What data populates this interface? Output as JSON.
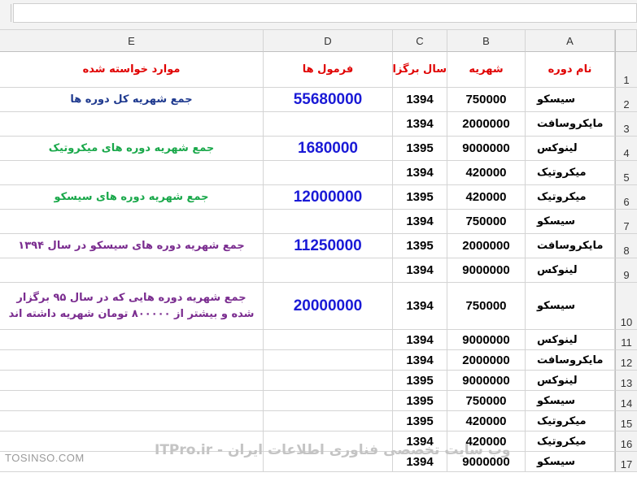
{
  "column_headers": [
    "E",
    "D",
    "C",
    "B",
    "A"
  ],
  "row_numbers": [
    "1",
    "2",
    "3",
    "4",
    "5",
    "6",
    "7",
    "8",
    "9",
    "10",
    "11",
    "12",
    "13",
    "14",
    "15",
    "16",
    "17"
  ],
  "header_row": {
    "a": "نام دوره",
    "b": "شهریه",
    "c": "سال برگزاری",
    "d": "فرمول ها",
    "e": "موارد خواسته شده"
  },
  "rows": [
    {
      "course": "سیسکو",
      "fee": "750000",
      "year": "1394"
    },
    {
      "course": "مایکروسافت",
      "fee": "2000000",
      "year": "1394"
    },
    {
      "course": "لینوکس",
      "fee": "9000000",
      "year": "1395"
    },
    {
      "course": "میکروتیک",
      "fee": "420000",
      "year": "1394"
    },
    {
      "course": "میکروتیک",
      "fee": "420000",
      "year": "1395"
    },
    {
      "course": "سیسکو",
      "fee": "750000",
      "year": "1394"
    },
    {
      "course": "مایکروسافت",
      "fee": "2000000",
      "year": "1395"
    },
    {
      "course": "لینوکس",
      "fee": "9000000",
      "year": "1394"
    },
    {
      "course": "سیسکو",
      "fee": "750000",
      "year": "1394"
    },
    {
      "course": "لینوکس",
      "fee": "9000000",
      "year": "1394"
    },
    {
      "course": "مایکروسافت",
      "fee": "2000000",
      "year": "1394"
    },
    {
      "course": "لینوکس",
      "fee": "9000000",
      "year": "1395"
    },
    {
      "course": "سیسکو",
      "fee": "750000",
      "year": "1395"
    },
    {
      "course": "میکروتیک",
      "fee": "420000",
      "year": "1395"
    },
    {
      "course": "میکروتیک",
      "fee": "420000",
      "year": "1394"
    },
    {
      "course": "سیسکو",
      "fee": "9000000",
      "year": "1394"
    }
  ],
  "questions": [
    {
      "text": "جمع شهریه کل دوره ها",
      "formula": "55680000",
      "color": "#1f3a8f"
    },
    {
      "text": "جمع شهریه دوره های میکروتیک",
      "formula": "1680000",
      "color": "#19a84a"
    },
    {
      "text": "جمع شهریه دوره های سیسکو",
      "formula": "12000000",
      "color": "#19a84a"
    },
    {
      "text": "جمع شهریه دوره های سیسکو در سال ۱۳۹۴",
      "formula": "11250000",
      "color": "#7a2c8f"
    },
    {
      "text": "جمع شهریه دوره هایی که در سال ۹۵ برگزار شده و بیشتر از ۸۰۰۰۰۰ تومان شهریه داشته اند",
      "formula": "20000000",
      "color": "#7a2c8f"
    }
  ],
  "watermark": {
    "left": "TOSINSO.COM",
    "main": "ITPro.ir - وب سایت تخصصی فناوری اطلاعات ایران"
  },
  "colors": {
    "header_text": "#e00000",
    "formula_text": "#1a1ad6",
    "grid_line": "#d4d4d4",
    "header_bg": "#f2f2f2"
  }
}
